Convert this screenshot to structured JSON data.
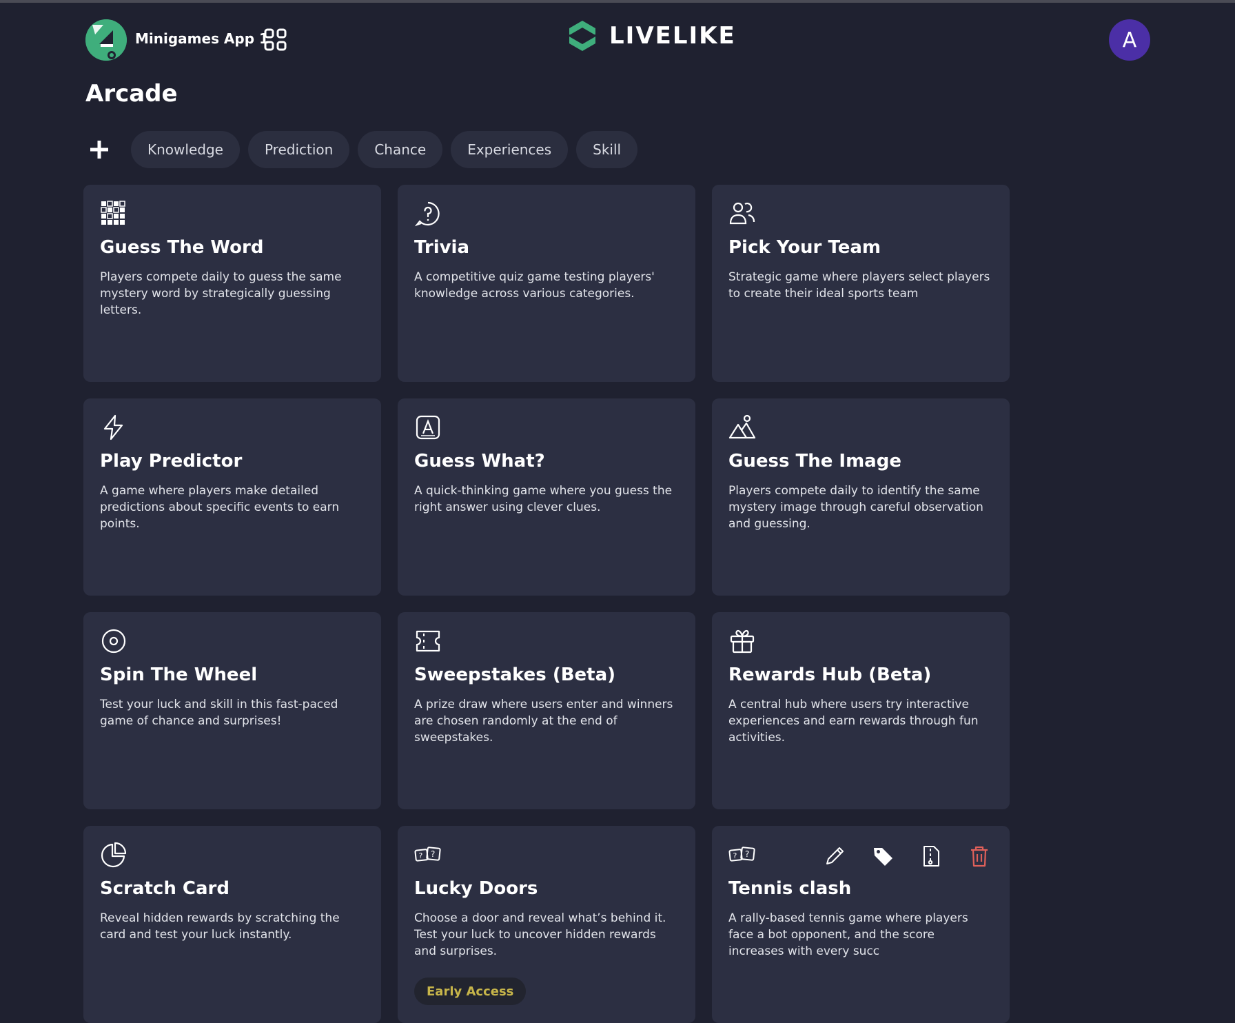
{
  "header": {
    "app_name": "Minigames App 1",
    "brand": "LIVELIKE",
    "avatar_letter": "A"
  },
  "page": {
    "title": "Arcade"
  },
  "filters": [
    "Knowledge",
    "Prediction",
    "Chance",
    "Experiences",
    "Skill"
  ],
  "cards": [
    {
      "icon": "grid-puzzle-icon",
      "title": "Guess The Word",
      "desc": "Players compete daily to guess the same mystery word by strategically guessing letters."
    },
    {
      "icon": "question-bubble-icon",
      "title": "Trivia",
      "desc": "A competitive quiz game testing players' knowledge across various categories."
    },
    {
      "icon": "users-icon",
      "title": "Pick Your Team",
      "desc": "Strategic game where players select players to create their ideal sports team"
    },
    {
      "icon": "lightning-icon",
      "title": "Play Predictor",
      "desc": "A game where players make detailed predictions about specific events to earn points."
    },
    {
      "icon": "letter-a-box-icon",
      "title": "Guess What?",
      "desc": "A quick-thinking game where you guess the right answer using clever clues."
    },
    {
      "icon": "image-mountain-icon",
      "title": "Guess The Image",
      "desc": "Players compete daily to identify the same mystery image through careful observation and guessing."
    },
    {
      "icon": "target-wheel-icon",
      "title": "Spin The Wheel",
      "desc": "Test your luck and skill in this fast-paced game of chance and surprises!"
    },
    {
      "icon": "ticket-icon",
      "title": "Sweepstakes (Beta)",
      "desc": "A prize draw where users enter and winners are chosen randomly at the end of sweepstakes."
    },
    {
      "icon": "gift-icon",
      "title": "Rewards Hub (Beta)",
      "desc": "A central hub where users try interactive experiences and earn rewards through fun activities."
    },
    {
      "icon": "pie-clock-icon",
      "title": "Scratch Card",
      "desc": "Reveal hidden rewards by scratching the card and test your luck instantly."
    },
    {
      "icon": "mystery-cards-icon",
      "title": "Lucky Doors",
      "desc": "Choose a door and reveal what’s behind it. Test your luck to uncover hidden rewards and surprises.",
      "badge": "Early Access"
    },
    {
      "icon": "mystery-cards-icon",
      "title": "Tennis clash",
      "desc": "A rally-based tennis game where players face a bot opponent, and the score increases with every succ",
      "actions": [
        "edit-icon",
        "tag-icon",
        "document-icon",
        "trash-icon"
      ]
    }
  ],
  "colors": {
    "background": "#1f2130",
    "card": "#2c2f42",
    "chip": "#2b2e3f",
    "brand_green": "#3fae7c",
    "avatar": "#4b2fa6",
    "badge_text": "#c7b54a",
    "danger": "#e0605a"
  }
}
